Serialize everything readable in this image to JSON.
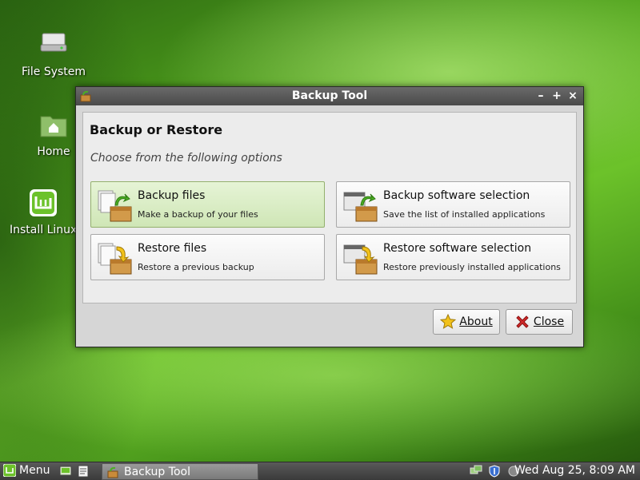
{
  "desktop": {
    "icons": [
      {
        "label": "File System"
      },
      {
        "label": "Home"
      },
      {
        "label": "Install Linux Mint"
      }
    ]
  },
  "window": {
    "title": "Backup Tool",
    "heading": "Backup or Restore",
    "subtitle": "Choose from the following options",
    "options": [
      {
        "title": "Backup files",
        "desc": "Make a backup of your files"
      },
      {
        "title": "Backup software selection",
        "desc": "Save the list of installed applications"
      },
      {
        "title": "Restore files",
        "desc": "Restore a previous backup"
      },
      {
        "title": "Restore software selection",
        "desc": "Restore previously installed applications"
      }
    ],
    "buttons": {
      "about": "About",
      "close": "Close"
    },
    "controls": {
      "minimize": "–",
      "maximize": "+",
      "close": "×"
    }
  },
  "taskbar": {
    "menu_label": "Menu",
    "task_label": "Backup Tool",
    "clock": "Wed Aug 25,  8:09 AM"
  },
  "colors": {
    "accent_green": "#6cc22a",
    "selected_option": "#cfe6b6",
    "close_icon_red": "#d22a2a",
    "about_star_yellow": "#f2c21a"
  }
}
